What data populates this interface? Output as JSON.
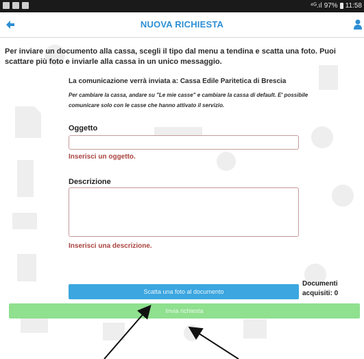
{
  "status_bar": {
    "signal_text": "⁴ᴳ.ıl",
    "battery": "97%",
    "time": "11:58"
  },
  "app_bar": {
    "title": "NUOVA RICHIESTA",
    "back_icon": "arrow-left-icon",
    "user_icon": "user-icon",
    "accent_color": "#2d8fd5"
  },
  "intro": "Per inviare un documento alla cassa, scegli il tipo dal menu a tendina e scatta una foto. Puoi scattare più foto e inviarle alla cassa in un unico messaggio.",
  "send_to": "La comunicazione verrà inviata a: Cassa Edile Paritetica di Brescia",
  "note": "Per cambiare la cassa, andare su \"Le mie casse\" e cambiare la cassa di default. E' possibile comunicare solo con le casse che hanno attivato il servizio.",
  "form": {
    "subject_label": "Oggetto",
    "subject_value": "",
    "subject_error": "Inserisci un oggetto.",
    "description_label": "Descrizione",
    "description_value": "",
    "description_error": "Inserisci una descrizione."
  },
  "photo_button": "Scatta una foto al documento",
  "documents_acquired": "Documenti acquisiti: 0",
  "send_button": "Invia richiesta",
  "colors": {
    "photo_button": "#3ba6e0",
    "send_button": "#8fe08f",
    "error": "#a9433f"
  }
}
